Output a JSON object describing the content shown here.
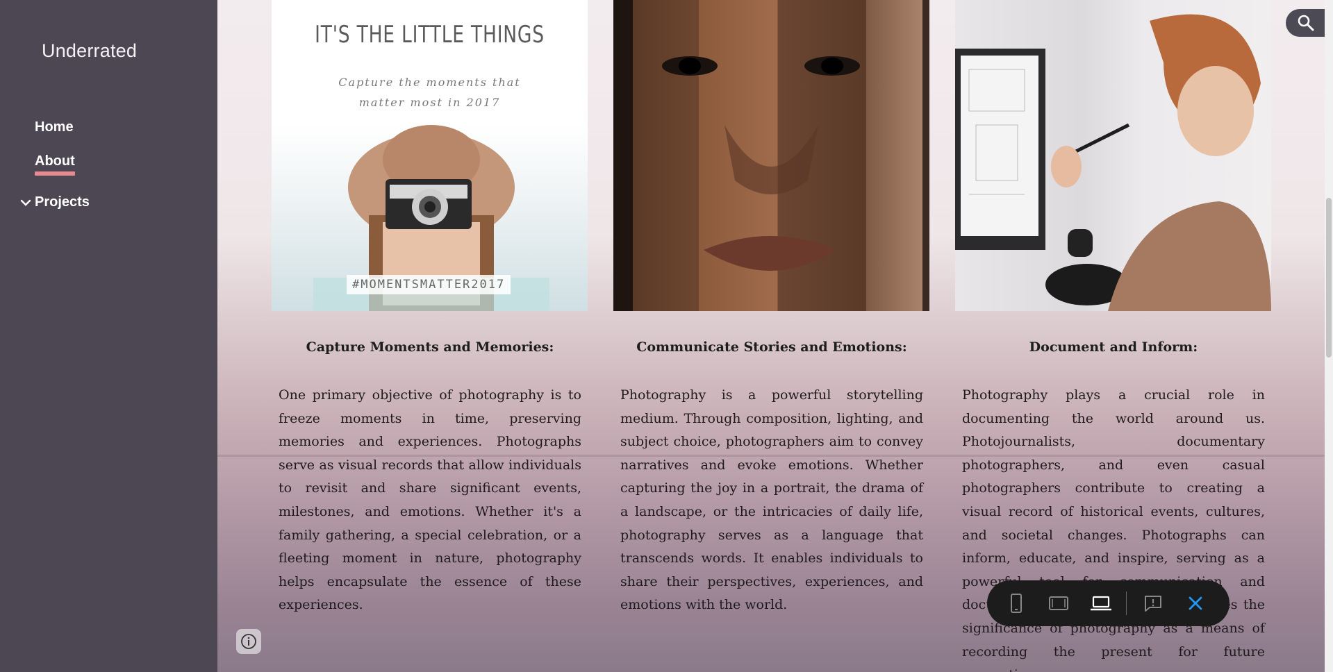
{
  "sidebar": {
    "site_title": "Underrated",
    "nav": [
      {
        "label": "Home"
      },
      {
        "label": "About",
        "active": true
      },
      {
        "label": "Projects",
        "expandable": true
      }
    ]
  },
  "columns": [
    {
      "image": {
        "poster_title": "IT'S THE LITTLE THINGS",
        "poster_subtitle": "Capture the moments that\nmatter most in 2017",
        "poster_hashtag": "#MOMENTSMATTER2017"
      },
      "heading": "Capture Moments and Memories:",
      "body": "One primary objective of photography is to freeze moments in time, preserving memories and experiences. Photographs serve as visual records that allow individuals to revisit and share significant events, milestones, and emotions. Whether it's a family gathering, a special celebration, or a fleeting moment in nature, photography helps encapsulate the essence of these experiences."
    },
    {
      "image": {},
      "heading": "Communicate Stories and Emotions:",
      "body": "Photography is a powerful storytelling medium. Through composition, lighting, and subject choice, photographers aim to convey narratives and evoke emotions. Whether capturing the joy in a portrait, the drama of a landscape, or the intricacies of daily life, photography serves as a language that transcends words. It enables individuals to share their perspectives, experiences, and emotions with the world."
    },
    {
      "image": {},
      "heading": "Document and Inform:",
      "body": "Photography plays a crucial role in documenting the world around us. Photojournalists, documentary photographers, and even casual photographers contribute to creating a visual record of historical events, cultures, and societal changes. Photographs can inform, educate, and inspire, serving as a powerful tool for communication and documentation. This further emphasizes the significance of photography as a means of recording the present for future generations."
    }
  ],
  "toolbar": {
    "buttons": [
      "phone-icon",
      "tablet-icon",
      "laptop-icon",
      "report-icon",
      "close-icon"
    ],
    "active": "laptop-icon",
    "accent": "#2196f3"
  },
  "colors": {
    "sidebar_bg": "#4d4753",
    "nav_underline": "#e88b8e"
  }
}
